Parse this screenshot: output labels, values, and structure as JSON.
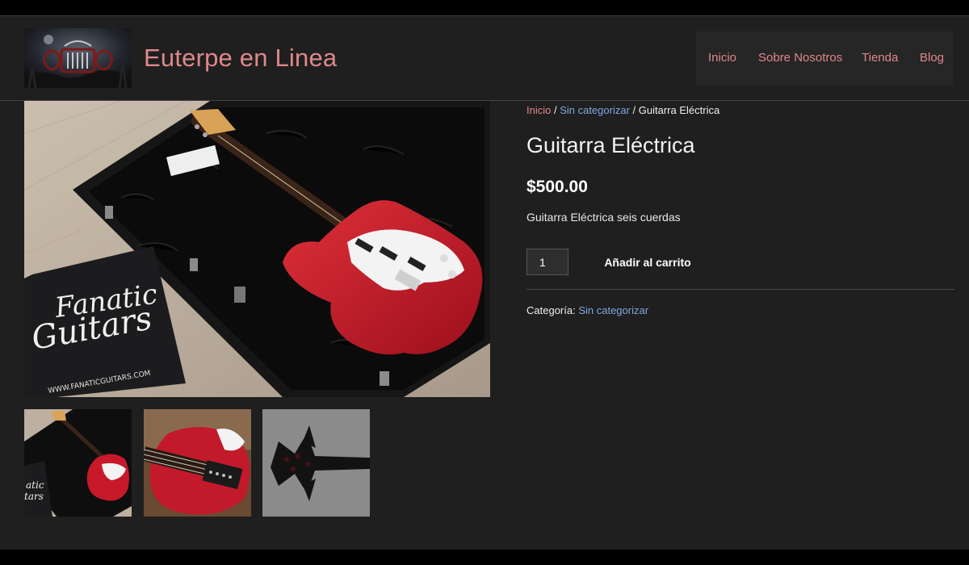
{
  "site": {
    "title": "Euterpe en Linea"
  },
  "nav": {
    "items": [
      {
        "label": "Inicio"
      },
      {
        "label": "Sobre Nosotros"
      },
      {
        "label": "Tienda"
      },
      {
        "label": "Blog"
      }
    ]
  },
  "breadcrumb": {
    "home": "Inicio",
    "sep1": " / ",
    "category": "Sin categorizar",
    "sep2": " / ",
    "current": "Guitarra Eléctrica"
  },
  "product": {
    "title": "Guitarra Eléctrica",
    "price": "$500.00",
    "description": "Guitarra Eléctrica seis cuerdas",
    "quantity": "1",
    "add_to_cart_label": "Añadir al carrito",
    "category_label": "Categoría: ",
    "category_value": "Sin categorizar"
  },
  "image": {
    "pillow_text_line1": "Fanatic",
    "pillow_text_line2": "Guitars",
    "pillow_url": "WWW.FANATICGUITARS.COM"
  },
  "colors": {
    "accent_pink": "#e0888a",
    "link_blue": "#7fa7e0",
    "background": "#1f1f1f",
    "guitar_red": "#c8192b"
  }
}
